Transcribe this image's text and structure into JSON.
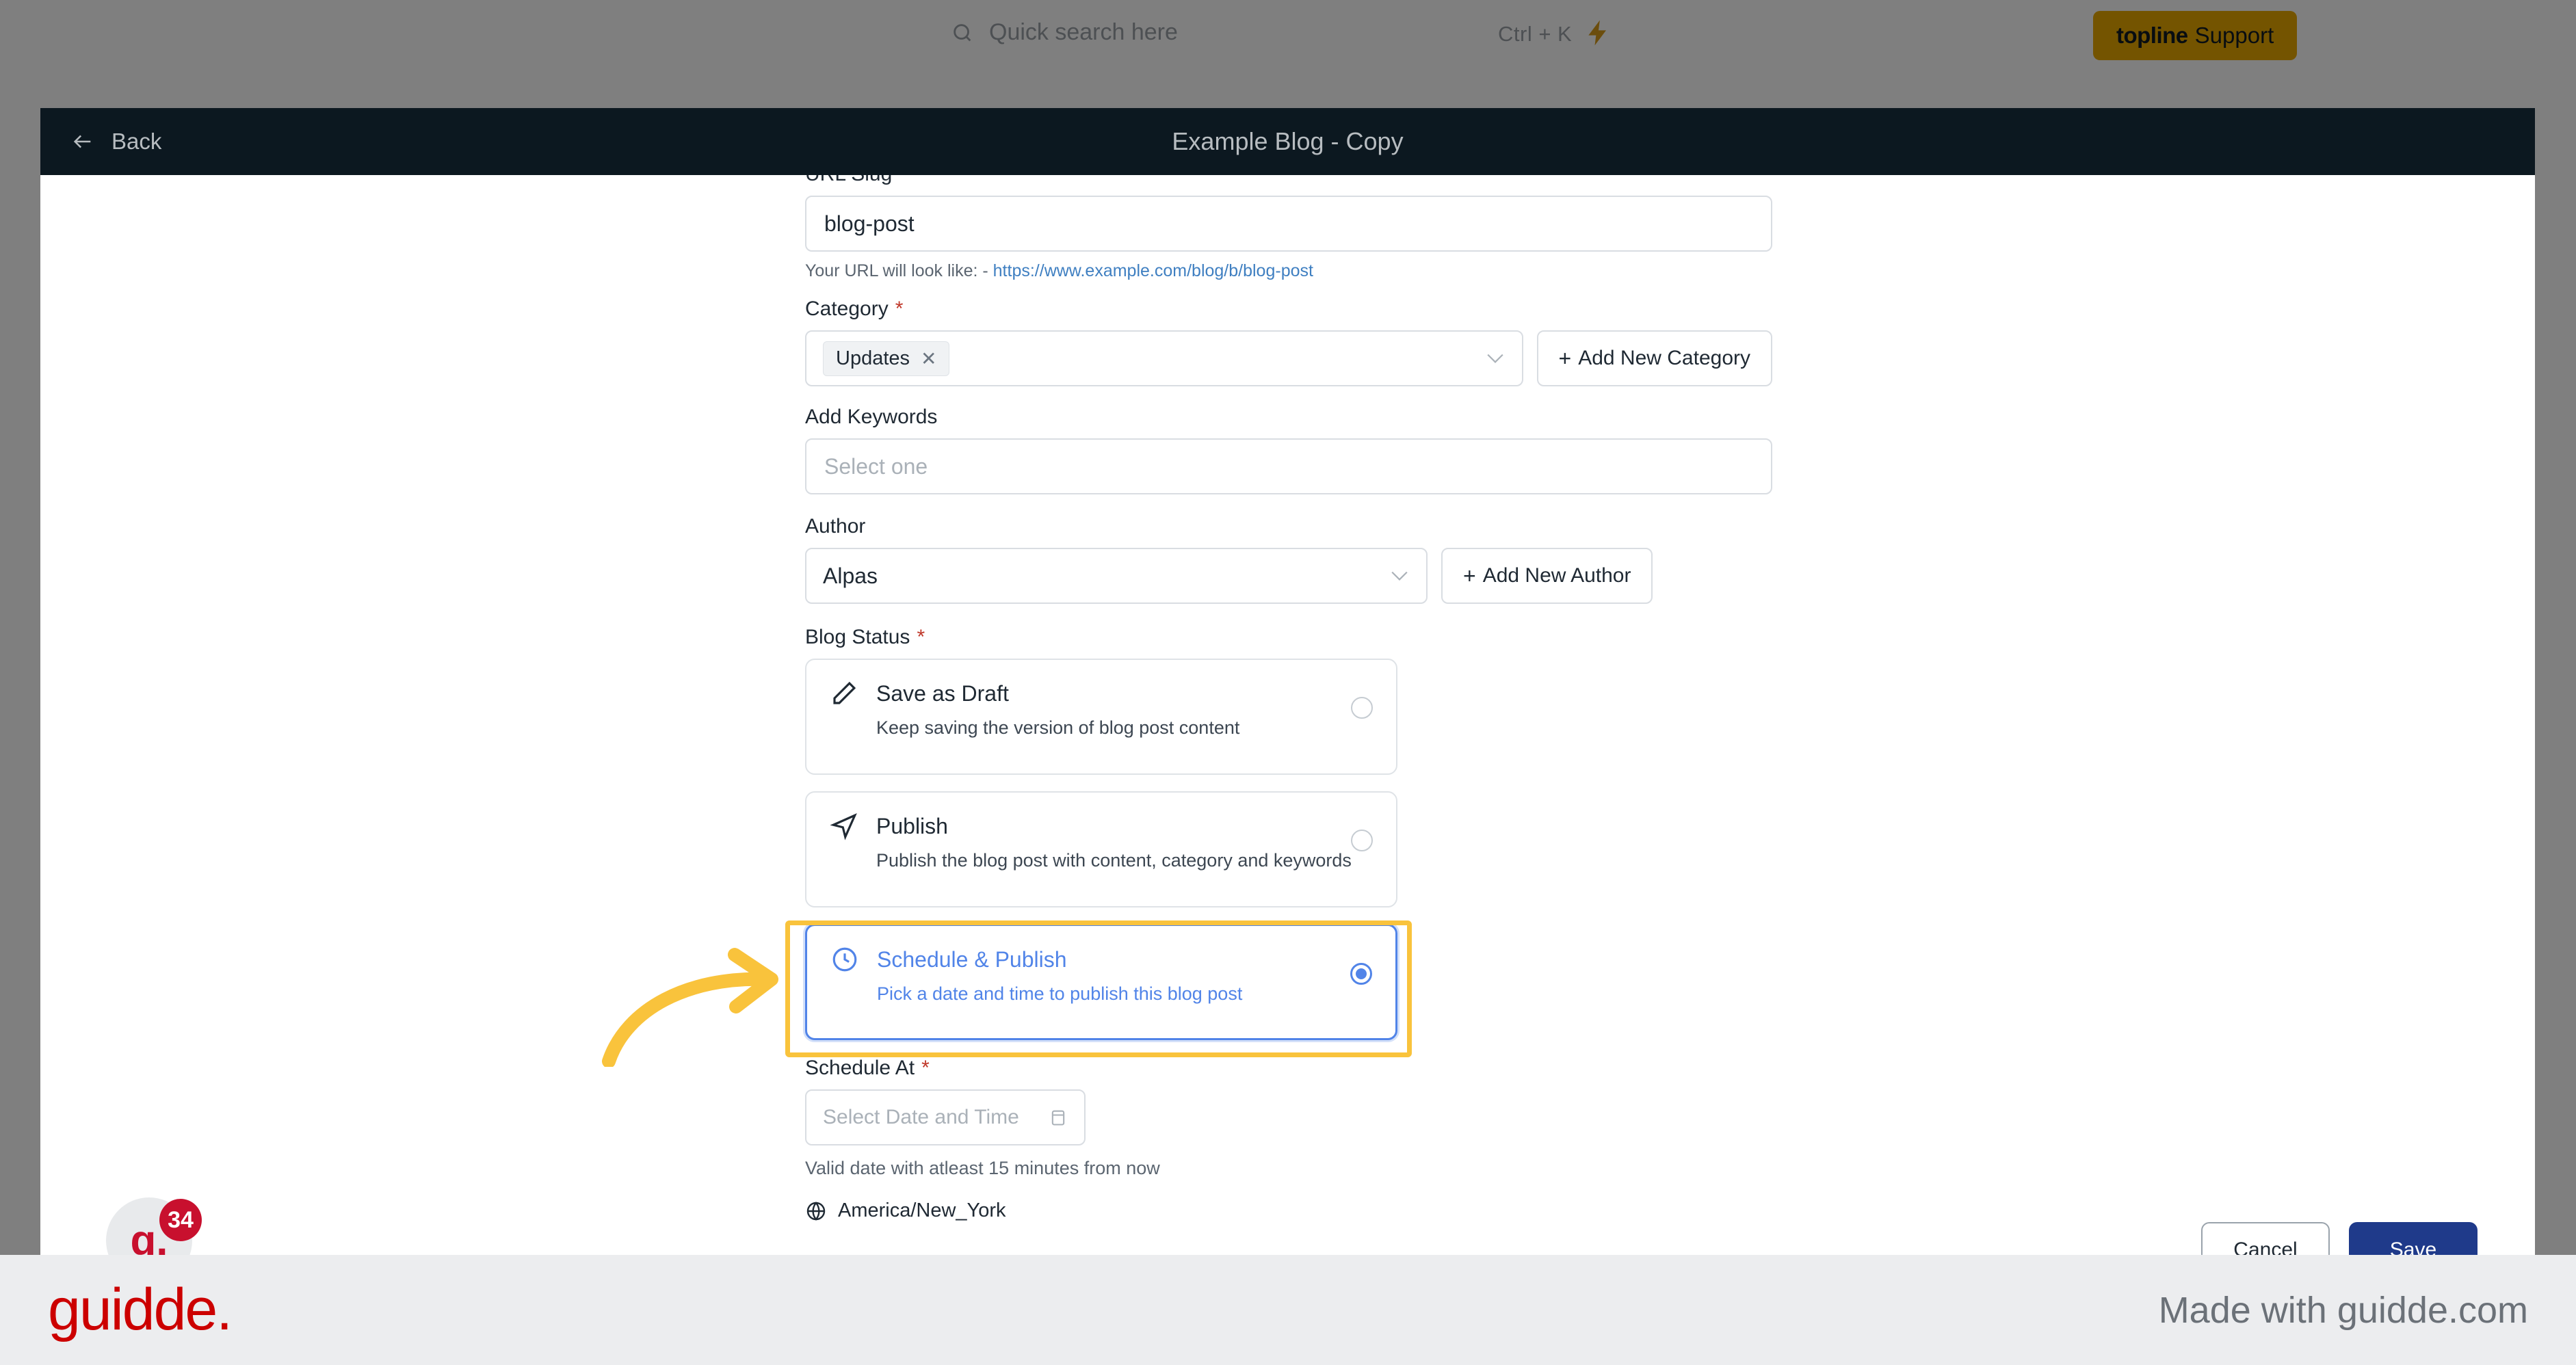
{
  "app": {
    "search": {
      "placeholder": "Quick search here",
      "icon": "search-icon",
      "shortcut": "Ctrl + K"
    },
    "support_badge": {
      "brand": "topline",
      "label": "Support"
    }
  },
  "modal": {
    "back_label": "Back",
    "title": "Example Blog - Copy",
    "form": {
      "url_slug": {
        "label": "URL Slug",
        "value": "blog-post"
      },
      "url_helper": {
        "prefix": "Your URL will look like: -",
        "link": "https://www.example.com/blog/b/blog-post"
      },
      "category": {
        "label": "Category",
        "required": "*",
        "tag": "Updates",
        "tag_remove": "✕",
        "add_button": "Add New Category",
        "plus": "+"
      },
      "keywords": {
        "label": "Add Keywords",
        "placeholder": "Select one"
      },
      "author": {
        "label": "Author",
        "value": "Alpas",
        "add_button": "Add New Author",
        "plus": "+"
      },
      "blog_status": {
        "label": "Blog Status",
        "required": "*",
        "options": [
          {
            "icon": "pencil-icon",
            "title": "Save as Draft",
            "description": "Keep saving the version of blog post content",
            "selected": false
          },
          {
            "icon": "paper-plane-icon",
            "title": "Publish",
            "description": "Publish the blog post with content, category and keywords",
            "selected": false
          },
          {
            "icon": "clock-icon",
            "title": "Schedule & Publish",
            "description": "Pick a date and time to publish this blog post",
            "selected": true
          }
        ]
      },
      "schedule_at": {
        "label": "Schedule At",
        "required": "*",
        "placeholder": "Select Date and Time",
        "helper": "Valid date with atleast 15 minutes from now",
        "timezone": "America/New_York"
      }
    },
    "actions": {
      "cancel": "Cancel",
      "save": "Save"
    }
  },
  "widget": {
    "badge_count": "34",
    "logo": "g."
  },
  "footer": {
    "logo": "guidde.",
    "made_with": "Made with guidde.com"
  },
  "colors": {
    "accent_blue": "#2b6ae3",
    "highlight_yellow": "#f9c33c",
    "brand_red": "#cc0000",
    "header_dark": "#0c1820",
    "support_gold": "#e9a900"
  }
}
